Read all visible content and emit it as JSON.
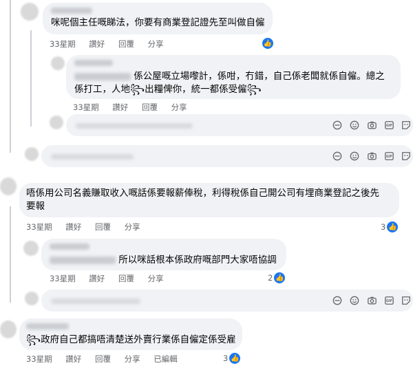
{
  "actions": {
    "time": "33星期",
    "like": "讚好",
    "reply": "回覆",
    "share": "分享",
    "edited": "已編輯"
  },
  "comments": [
    {
      "text": "咪呢個主任嘅睇法，你要有商業登記證先至叫做自僱"
    },
    {
      "text_line1": "係公屋嘅立場嚟計，係咁，冇錯，自己係老闆就係自僱。總之",
      "text_line2": "係打工，人地꧂出糧俾你，統一都係受僱꧂"
    },
    {
      "text_line1": "唔係用公司名義賺取收入嘅話係要報薪俸稅，利得稅係自己開公司有埋商業登記之後先",
      "text_line2": "要報",
      "reactions": "3"
    },
    {
      "text": "所以咪話根本係政府嘅部門大家唔協調",
      "reactions": "2"
    },
    {
      "text": "꧂政府自己都搞唔清楚送外賣行業係自僱定係受雇",
      "reactions": "3"
    }
  ],
  "icons": [
    "globe-like-icon",
    "emoji-icon",
    "camera-icon",
    "gif-icon",
    "sticker-icon"
  ],
  "colors": {
    "bubble": "#f0f2f5",
    "secondary_text": "#65676b",
    "like_blue": "#1877f2"
  }
}
